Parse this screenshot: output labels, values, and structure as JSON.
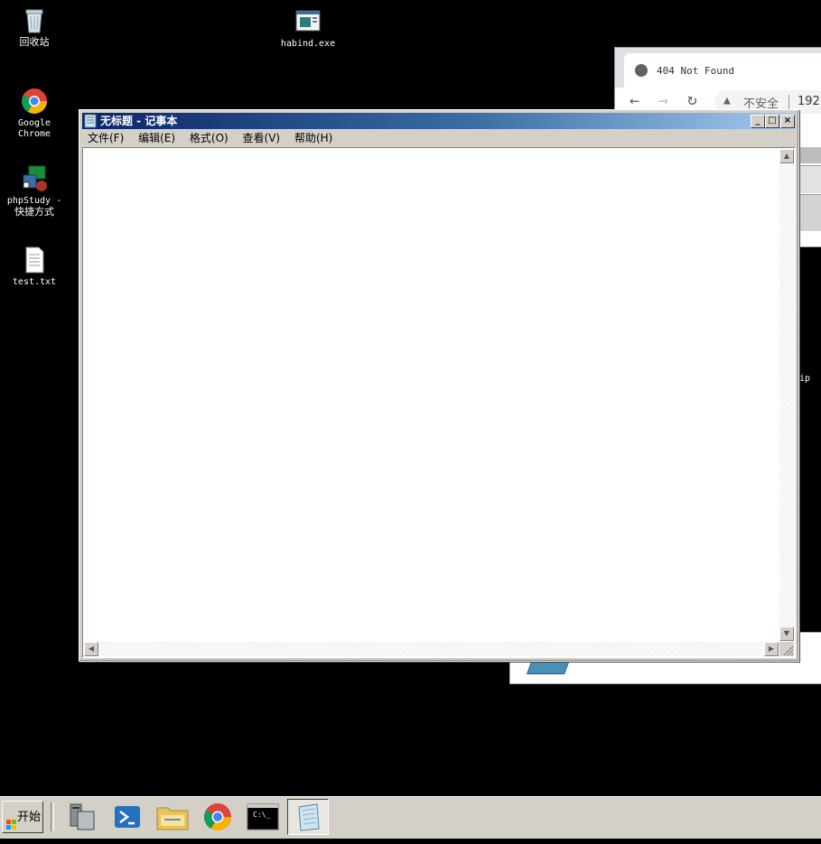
{
  "desktop": {
    "icons": [
      {
        "label": "回收站"
      },
      {
        "label": "habind.exe"
      },
      {
        "label_line1": "Google",
        "label_line2": "Chrome"
      },
      {
        "label_line1": "phpStudy -",
        "label_line2": "快捷方式"
      },
      {
        "label": "test.txt"
      }
    ]
  },
  "browser": {
    "tab_title": "404 Not Found",
    "security_label": "不安全",
    "address_partial": "192.",
    "side_text": "ip"
  },
  "notepad": {
    "title": "无标题 - 记事本",
    "menu": [
      "文件(F)",
      "编辑(E)",
      "格式(O)",
      "查看(V)",
      "帮助(H)"
    ],
    "content": "",
    "caption_buttons": {
      "minimize": "_",
      "maximize": "□",
      "close": "×"
    }
  },
  "taskbar": {
    "start_label": "开始",
    "items": [
      {
        "icon": "server-manager-icon"
      },
      {
        "icon": "powershell-icon"
      },
      {
        "icon": "file-explorer-icon"
      },
      {
        "icon": "chrome-icon"
      },
      {
        "icon": "cmd-icon",
        "text": "C:\\_"
      },
      {
        "icon": "notepad-icon",
        "active": true
      }
    ]
  }
}
